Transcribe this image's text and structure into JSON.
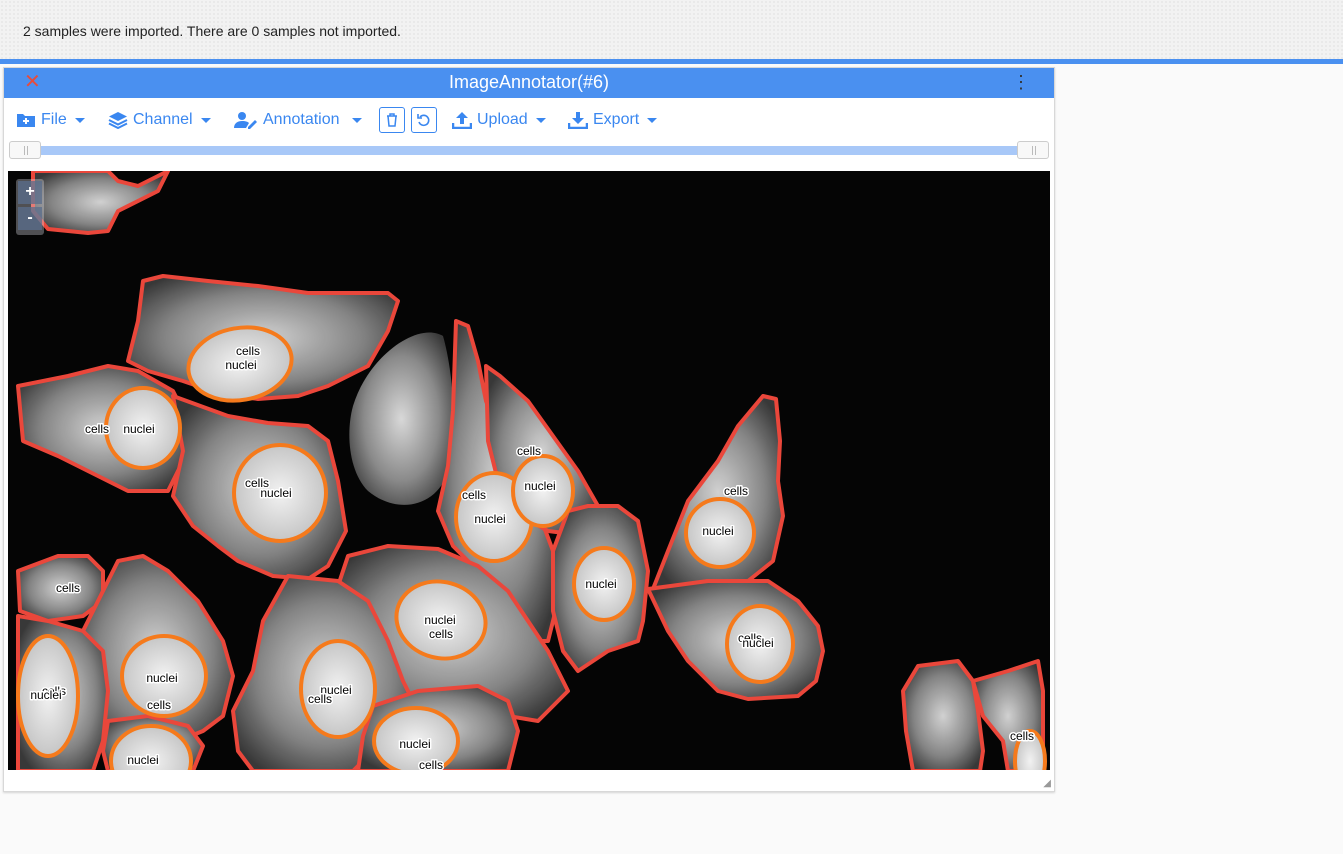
{
  "notification": {
    "text": "2 samples were imported. There are 0 samples not imported."
  },
  "window": {
    "title": "ImageAnnotator(#6)"
  },
  "toolbar": {
    "file_label": "File",
    "channel_label": "Channel",
    "annotation_label": "Annotation",
    "upload_label": "Upload",
    "export_label": "Export"
  },
  "zoom": {
    "in_label": "+",
    "out_label": "-"
  },
  "colors": {
    "accent": "#4a90f0",
    "cell_outline": "#f24a3d",
    "nucleus_outline": "#f57a1c"
  },
  "icons": [
    "close-icon",
    "kebab-menu-icon",
    "file-add-icon",
    "layers-icon",
    "user-edit-icon",
    "trash-icon",
    "undo-icon",
    "upload-icon",
    "download-icon"
  ],
  "labels": {
    "cells": "cells",
    "nuclei": "nuclei"
  }
}
